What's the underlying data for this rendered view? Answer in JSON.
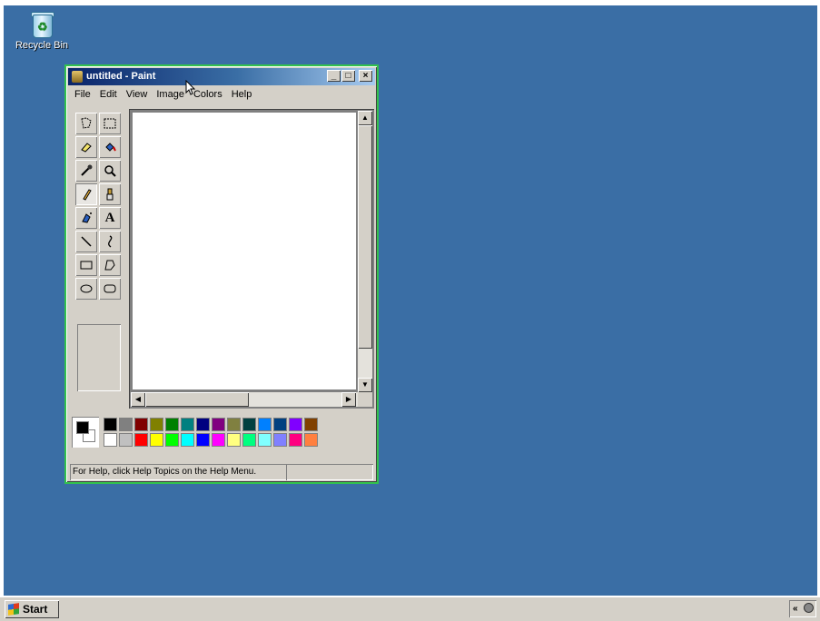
{
  "desktop": {
    "icons": [
      {
        "label": "Recycle Bin",
        "icon": "recycle-bin-icon"
      }
    ]
  },
  "paint": {
    "title": "untitled - Paint",
    "menu": [
      "File",
      "Edit",
      "View",
      "Image",
      "Colors",
      "Help"
    ],
    "tools": [
      "free-form-select-icon",
      "select-icon",
      "eraser-icon",
      "fill-bucket-icon",
      "pick-color-icon",
      "magnifier-icon",
      "pencil-icon",
      "brush-icon",
      "airbrush-icon",
      "text-icon",
      "line-icon",
      "curve-icon",
      "rectangle-icon",
      "polygon-icon",
      "ellipse-icon",
      "rounded-rectangle-icon"
    ],
    "text_tool_glyph": "A",
    "selected_tool": "pencil-icon",
    "foreground_color": "#000000",
    "background_color": "#FFFFFF",
    "palette_top": [
      "#000000",
      "#808080",
      "#800000",
      "#808000",
      "#008000",
      "#008080",
      "#000080",
      "#800080",
      "#808040",
      "#004040",
      "#0080FF",
      "#004080",
      "#8000FF",
      "#804000"
    ],
    "palette_bottom": [
      "#FFFFFF",
      "#C0C0C0",
      "#FF0000",
      "#FFFF00",
      "#00FF00",
      "#00FFFF",
      "#0000FF",
      "#FF00FF",
      "#FFFF80",
      "#00FF80",
      "#80FFFF",
      "#8080FF",
      "#FF0080",
      "#FF8040"
    ],
    "status": "For Help, click Help Topics on the Help Menu."
  },
  "taskbar": {
    "start_label": "Start",
    "tray_chevron": "«"
  }
}
